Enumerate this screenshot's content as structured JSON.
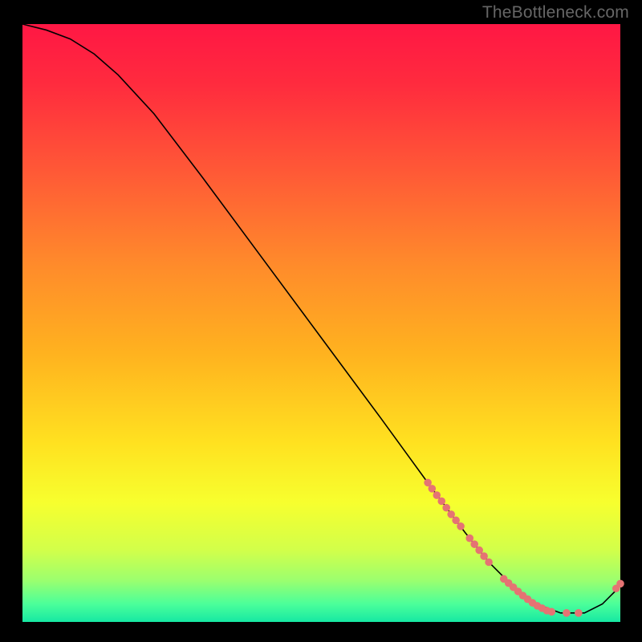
{
  "watermark": "TheBottleneck.com",
  "chart_data": {
    "type": "line",
    "title": "",
    "xlabel": "",
    "ylabel": "",
    "xlim": [
      0,
      100
    ],
    "ylim": [
      0,
      100
    ],
    "grid": false,
    "background_gradient": {
      "stops": [
        {
          "offset": 0.0,
          "color": "#ff1744"
        },
        {
          "offset": 0.1,
          "color": "#ff2b3e"
        },
        {
          "offset": 0.25,
          "color": "#ff5a36"
        },
        {
          "offset": 0.4,
          "color": "#ff8a2b"
        },
        {
          "offset": 0.55,
          "color": "#ffb21f"
        },
        {
          "offset": 0.7,
          "color": "#ffe120"
        },
        {
          "offset": 0.8,
          "color": "#f7ff2e"
        },
        {
          "offset": 0.88,
          "color": "#d2ff4a"
        },
        {
          "offset": 0.93,
          "color": "#9cff6e"
        },
        {
          "offset": 0.97,
          "color": "#4bff9a"
        },
        {
          "offset": 1.0,
          "color": "#16e8a3"
        }
      ]
    },
    "series": [
      {
        "name": "curve",
        "color": "#000000",
        "x": [
          0,
          4,
          8,
          12,
          16,
          22,
          30,
          40,
          50,
          60,
          68,
          74,
          78,
          82,
          86,
          90,
          94,
          97,
          99,
          100
        ],
        "y": [
          100,
          99,
          97.5,
          95,
          91.5,
          85,
          74.5,
          61,
          47.5,
          34,
          23,
          15,
          10,
          6,
          3,
          1.5,
          1.5,
          3,
          5,
          6
        ]
      }
    ],
    "scatter": [
      {
        "name": "markers",
        "color": "#e57373",
        "radius": 4.8,
        "points": [
          {
            "x": 67.8,
            "y": 23.3
          },
          {
            "x": 68.5,
            "y": 22.3
          },
          {
            "x": 69.3,
            "y": 21.2
          },
          {
            "x": 70.1,
            "y": 20.2
          },
          {
            "x": 70.9,
            "y": 19.1
          },
          {
            "x": 71.7,
            "y": 18.0
          },
          {
            "x": 72.5,
            "y": 17.0
          },
          {
            "x": 73.3,
            "y": 16.0
          },
          {
            "x": 74.8,
            "y": 14.0
          },
          {
            "x": 75.6,
            "y": 13.0
          },
          {
            "x": 76.4,
            "y": 12.0
          },
          {
            "x": 77.2,
            "y": 11.0
          },
          {
            "x": 78.0,
            "y": 10.0
          },
          {
            "x": 80.5,
            "y": 7.2
          },
          {
            "x": 81.3,
            "y": 6.5
          },
          {
            "x": 82.1,
            "y": 5.8
          },
          {
            "x": 82.9,
            "y": 5.1
          },
          {
            "x": 83.7,
            "y": 4.4
          },
          {
            "x": 84.5,
            "y": 3.8
          },
          {
            "x": 85.3,
            "y": 3.2
          },
          {
            "x": 86.1,
            "y": 2.7
          },
          {
            "x": 86.9,
            "y": 2.3
          },
          {
            "x": 87.7,
            "y": 1.9
          },
          {
            "x": 88.5,
            "y": 1.7
          },
          {
            "x": 91.0,
            "y": 1.5
          },
          {
            "x": 93.0,
            "y": 1.5
          },
          {
            "x": 99.3,
            "y": 5.6
          },
          {
            "x": 100.0,
            "y": 6.4
          }
        ]
      }
    ]
  }
}
